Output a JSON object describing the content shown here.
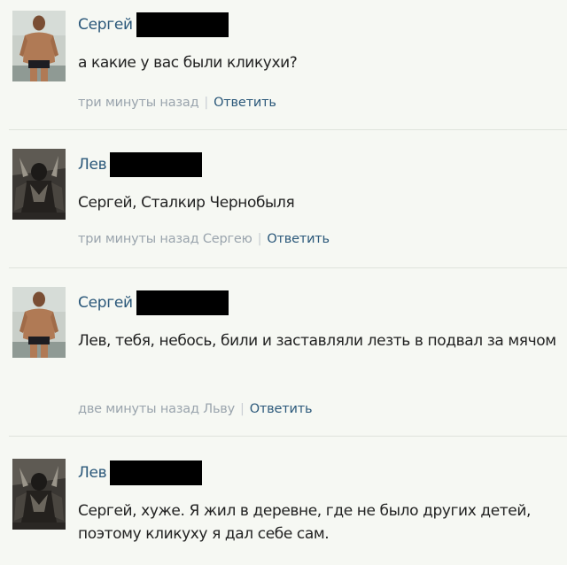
{
  "comments": [
    {
      "author": "Сергей",
      "text": "а какие у вас были кликухи?",
      "time": "три минуты назад",
      "reply_to": "",
      "reply_label": "Ответить",
      "avatar_icon": "shirtless-man-avatar"
    },
    {
      "author": "Лев",
      "text": "Сергей, Сталкир Чернобыля",
      "time": "три минуты назад",
      "reply_to": "Сергею",
      "reply_label": "Ответить",
      "avatar_icon": "dark-figure-avatar"
    },
    {
      "author": "Сергей",
      "text": "Лев, тебя, небось, били и заставляли лезть в подвал за мячом",
      "time": "две минуты назад",
      "reply_to": "Льву",
      "reply_label": "Ответить",
      "avatar_icon": "shirtless-man-avatar"
    },
    {
      "author": "Лев",
      "text": "Сергей, хуже. Я жил в деревне, где не было других детей, поэтому кликуху я дал себе сам.",
      "time": "",
      "reply_to": "",
      "reply_label": "",
      "avatar_icon": "dark-figure-avatar"
    }
  ],
  "colors": {
    "background": "#f6f8f3",
    "link": "#2b587a",
    "meta": "#9aa4ad",
    "redaction": "#000000"
  }
}
